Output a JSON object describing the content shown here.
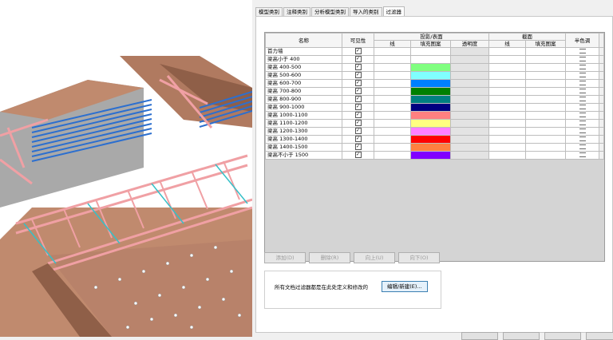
{
  "tabs": [
    "模型类别",
    "注释类别",
    "分析模型类别",
    "导入的类别",
    "过滤器"
  ],
  "active_tab": 4,
  "table": {
    "header": {
      "name": "名称",
      "visibility": "可见性",
      "projection_group": "投影/表面",
      "cut_group": "截面",
      "lines": "线",
      "fill_pattern": "填充图案",
      "transparency": "透明度",
      "cut_lines": "线",
      "cut_fill": "填充图案",
      "halftone": "半色调"
    },
    "rows": [
      {
        "name": "首力墙",
        "visible": true,
        "color": ""
      },
      {
        "name": "梁高小于 400",
        "visible": true,
        "color": ""
      },
      {
        "name": "梁高 400-500",
        "visible": true,
        "color": "#80ff80"
      },
      {
        "name": "梁高 500-600",
        "visible": true,
        "color": "#80ffff"
      },
      {
        "name": "梁高 600-700",
        "visible": true,
        "color": "#0080ff"
      },
      {
        "name": "梁高 700-800",
        "visible": true,
        "color": "#008000"
      },
      {
        "name": "梁高 800-900",
        "visible": true,
        "color": "#008080"
      },
      {
        "name": "梁高 900-1000",
        "visible": true,
        "color": "#000080"
      },
      {
        "name": "梁高 1000-1100",
        "visible": true,
        "color": "#ff8080"
      },
      {
        "name": "梁高 1100-1200",
        "visible": true,
        "color": "#ffff80"
      },
      {
        "name": "梁高 1200-1300",
        "visible": true,
        "color": "#ff80ff"
      },
      {
        "name": "梁高 1300-1400",
        "visible": true,
        "color": "#ff0000"
      },
      {
        "name": "梁高 1400-1500",
        "visible": true,
        "color": "#ff8040"
      },
      {
        "name": "梁高不小于 1500",
        "visible": true,
        "color": "#8000ff"
      }
    ]
  },
  "buttons": {
    "add": "添加(D)",
    "remove": "删除(R)",
    "up": "向上(U)",
    "down": "向下(O)"
  },
  "note": "所有文档过滤器都是在此处定义和修改的",
  "edit_button": "编辑/新建(E)...",
  "colors": {
    "wall": "#c08a6e",
    "wall_dark": "#8f5f48",
    "beam": "#f0a0a4",
    "blue_bars": "#2c6fcf",
    "cyan": "#36c0c8"
  }
}
